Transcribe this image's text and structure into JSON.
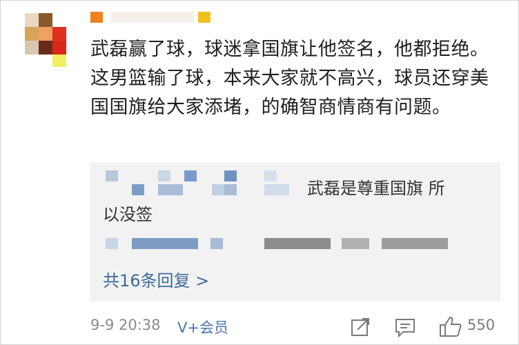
{
  "comment": {
    "text": "武磊赢了球，球迷拿国旗让他签名，他都拒绝。这男篮输了球，本来大家就不高兴，球员还穿美国国旗给大家添堵，的确智商情商有问题。"
  },
  "reply": {
    "text_part1": "武磊是尊重国旗 所",
    "text_part2": "以没签",
    "more_label": "共16条回复 >"
  },
  "footer": {
    "timestamp": "9-9 20:38",
    "vip_label": "V+会员",
    "likes": "550",
    "icons": [
      "share-icon",
      "comment-icon",
      "like-icon"
    ]
  },
  "colors": {
    "link_blue": "#3d6b9b",
    "vip_blue": "#4a74b0",
    "reply_bg": "#f2f2f2",
    "muted": "#8a8a8a"
  }
}
